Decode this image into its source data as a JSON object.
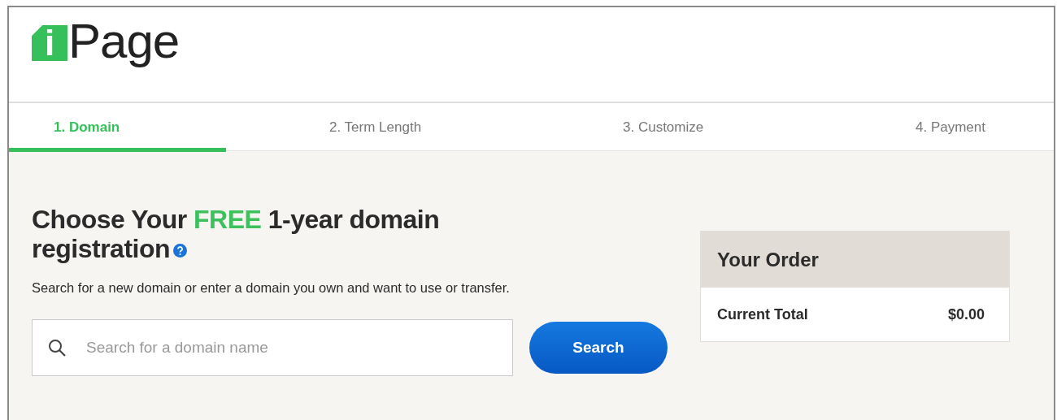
{
  "logo": {
    "mark": "i",
    "text": "Page"
  },
  "tabs": [
    {
      "label": "1. Domain",
      "selected": true
    },
    {
      "label": "2. Term Length",
      "selected": false
    },
    {
      "label": "3. Customize",
      "selected": false
    },
    {
      "label": "4. Payment",
      "selected": false
    }
  ],
  "heading": {
    "before": "Choose Your",
    "highlight": "FREE",
    "after": "1-year domain registration",
    "help_icon": true
  },
  "description": "Search for a new domain or enter a domain you own and want to use or transfer.",
  "search": {
    "placeholder": "Search for a domain name",
    "button": "Search"
  },
  "order": {
    "title": "Your Order",
    "total_label": "Current Total",
    "total_value": "$0.00"
  }
}
